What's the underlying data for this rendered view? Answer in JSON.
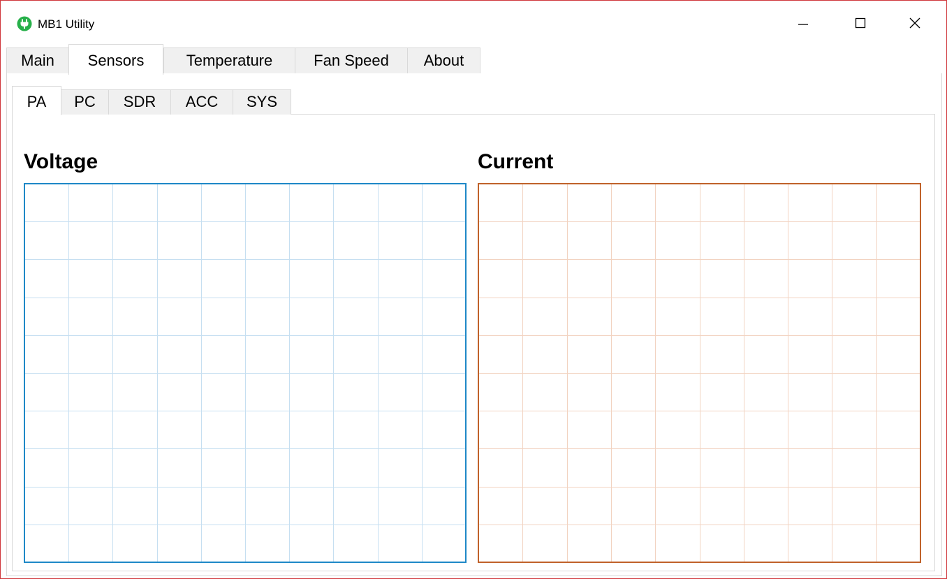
{
  "window": {
    "title": "MB1 Utility",
    "icon": "plug-icon"
  },
  "controls": {
    "minimize": "minimize-icon",
    "maximize": "maximize-icon",
    "close": "close-icon"
  },
  "main_tabs": [
    {
      "label": "Main",
      "active": false
    },
    {
      "label": "Sensors",
      "active": true
    },
    {
      "label": "Temperature",
      "active": false
    },
    {
      "label": "Fan Speed",
      "active": false
    },
    {
      "label": "About",
      "active": false
    }
  ],
  "sub_tabs": [
    {
      "label": "PA",
      "active": true
    },
    {
      "label": "PC",
      "active": false
    },
    {
      "label": "SDR",
      "active": false
    },
    {
      "label": "ACC",
      "active": false
    },
    {
      "label": "SYS",
      "active": false
    }
  ],
  "plots": [
    {
      "title": "Voltage",
      "border_color": "#1e88c7",
      "grid_color": "#c6dff1",
      "grid_columns": 10,
      "grid_rows": 10
    },
    {
      "title": "Current",
      "border_color": "#c0622a",
      "grid_color": "#f2d3c1",
      "grid_columns": 10,
      "grid_rows": 10
    }
  ]
}
